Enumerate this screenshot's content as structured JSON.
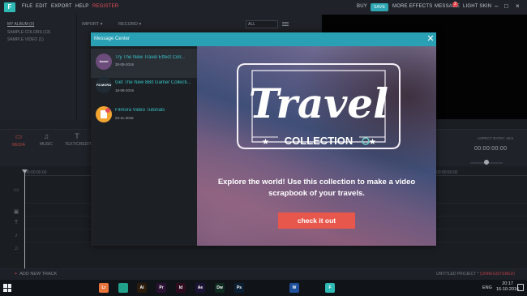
{
  "menubar": {
    "logo": "F",
    "items": [
      "FILE",
      "EDIT",
      "EXPORT",
      "HELP"
    ],
    "register": "REGISTER",
    "right": {
      "buy": "BUY",
      "save": "SAVE",
      "more_effects": "MORE EFFECTS",
      "message": "MESSAGE",
      "message_count": "2",
      "skin": "LIGHT SKIN"
    }
  },
  "media_panel": {
    "albums": [
      "MY ALBUM (0)",
      "SAMPLE COLORS (13)",
      "SAMPLE VIDEO (1)"
    ],
    "import": "IMPORT",
    "record": "RECORD",
    "filter": "ALL"
  },
  "type_tabs": [
    {
      "label": "MEDIA",
      "icon": "media-icon"
    },
    {
      "label": "MUSIC",
      "icon": "music-icon"
    },
    {
      "label": "TEXT/CREDIT",
      "icon": "text-icon"
    }
  ],
  "preview": {
    "aspect_label": "ASPECT RATIO: 16:9",
    "time": "00:00:00:00"
  },
  "timeline": {
    "start_tc": "00:00:00:00",
    "end_tc": "00:00:50:00"
  },
  "status": {
    "add_track": "ADD NEW TRACK",
    "project": "UNTITLED PROJECT *",
    "unregistered": "(UNREGISTERED)"
  },
  "dialog": {
    "title": "Message Center",
    "messages": [
      {
        "title": "Try The New Travel Effect Coll...",
        "date": "30-09-2016",
        "thumb": "travel",
        "thumb_color": "#6b4c7a"
      },
      {
        "title": "Get The New 8Bit Gamer Collecti...",
        "date": "16-08-2016",
        "thumb": "FILMORA",
        "thumb_color": "#1f2a33"
      },
      {
        "title": "Filmora Video Tutorials",
        "date": "23-11-2015",
        "thumb": "",
        "thumb_color": "#f2a531"
      }
    ],
    "promo": {
      "headline": "Travel",
      "subhead": "COLLECTION",
      "body": "Explore the world! Use this collection to make a video scrapbook of your travels.",
      "cta": "check it out"
    }
  },
  "taskbar": {
    "apps": [
      {
        "label": "Lr",
        "color": "#e8743b"
      },
      {
        "label": "",
        "color": "#21a08b"
      },
      {
        "label": "Ai",
        "color": "#2b1b0c"
      },
      {
        "label": "Pr",
        "color": "#2a1233"
      },
      {
        "label": "Id",
        "color": "#2f0b1f"
      },
      {
        "label": "Ae",
        "color": "#1a1335"
      },
      {
        "label": "Dw",
        "color": "#0f2a1e"
      },
      {
        "label": "Ps",
        "color": "#0a1f33"
      },
      {
        "label": "W",
        "color": "#1d4f9a"
      },
      {
        "label": "F",
        "color": "#2fb9b5"
      }
    ],
    "lang": "ENG",
    "time": "20:17",
    "date": "16-10-2016"
  },
  "colors": {
    "accent": "#2aa0b4",
    "brand_red": "#e64d5a",
    "cta": "#e7574c"
  }
}
